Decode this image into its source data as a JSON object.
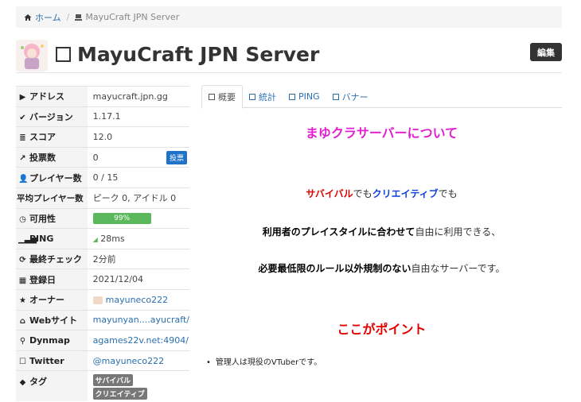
{
  "breadcrumb": {
    "home": "ホーム",
    "current": "MayuCraft JPN Server"
  },
  "header": {
    "title": "MayuCraft JPN Server",
    "edit_label": "編集"
  },
  "info": {
    "rows": [
      {
        "icon": "play-icon",
        "key": "アドレス",
        "value": "mayucraft.jpn.gg"
      },
      {
        "icon": "check-icon",
        "key": "バージョン",
        "value": "1.17.1"
      },
      {
        "icon": "bars-icon",
        "key": "スコア",
        "value": "12.0"
      },
      {
        "icon": "external-icon",
        "key": "投票数",
        "value": "0",
        "button": "投票"
      },
      {
        "icon": "user-icon",
        "key": "プレイヤー数",
        "value": "0 / 15"
      },
      {
        "icon": "",
        "key": "平均プレイヤー数",
        "value": "ピーク 0, アイドル 0"
      },
      {
        "icon": "clock-icon",
        "key": "可用性",
        "value": "99%"
      },
      {
        "icon": "signal-icon",
        "key": "PING",
        "value": "28ms"
      },
      {
        "icon": "refresh-icon",
        "key": "最終チェック",
        "value": "2分前"
      },
      {
        "icon": "calendar-icon",
        "key": "登録日",
        "value": "2021/12/04"
      },
      {
        "icon": "star-icon",
        "key": "オーナー",
        "value": "mayuneco222"
      },
      {
        "icon": "home-icon",
        "key": "Webサイト",
        "value": "mayunyan....ayucraft/"
      },
      {
        "icon": "pin-icon",
        "key": "Dynmap",
        "value": "agames22v.net:4904/"
      },
      {
        "icon": "square-icon",
        "key": "Twitter",
        "value": "@mayuneco222"
      },
      {
        "icon": "tag-icon",
        "key": "タグ",
        "tags": [
          "サバイバル",
          "クリエイティブ"
        ]
      }
    ],
    "availability_fraction": 0.99
  },
  "tabs": [
    {
      "label": "概要"
    },
    {
      "label": "統計"
    },
    {
      "label": "PING"
    },
    {
      "label": "バナー"
    }
  ],
  "content": {
    "heading": "まゆクラサーバーについて",
    "line1": {
      "a": "サバイバル",
      "b": "でも",
      "c": "クリエイティブ",
      "d": "でも"
    },
    "line2": {
      "a": "利用者のプレイスタイルに合わせて",
      "b": "自由に利用できる、"
    },
    "line3": {
      "a": "必要最低限のルール以外規制のない",
      "b": "自由なサーバーです。"
    },
    "points_heading": "ここがポイント",
    "bullet": "管理人は現役のVTuberです。"
  },
  "colors": {
    "heading_magenta": "#e020d0",
    "accent_red": "#e00000",
    "accent_blue": "#1040e0",
    "link": "#2a6fb0",
    "progress_green": "#5cb85c"
  }
}
